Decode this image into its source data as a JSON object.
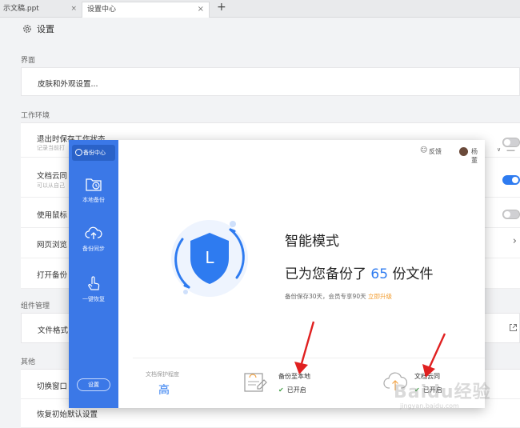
{
  "tabs": [
    {
      "label": "示文稿.ppt",
      "close": "×"
    },
    {
      "label": "设置中心",
      "close": "×"
    }
  ],
  "new_tab": "+",
  "settings": {
    "title": "设置",
    "sections": {
      "interface": "界面",
      "work_env": "工作环境",
      "components": "组件管理",
      "other": "其他"
    },
    "rows": {
      "skin": "皮肤和外观设置...",
      "save_on_exit": "退出时保存工作状态",
      "save_on_exit_sub": "记录当前打",
      "cloud_sync": "文档云同",
      "cloud_sync_sub": "可以从自己",
      "mouse": "使用鼠标",
      "web_browse": "网页浏览",
      "open_backup": "打开备份",
      "file_format": "文件格式",
      "switch_window": "切换窗口",
      "restore_default": "恢复初始默认设置"
    },
    "toggles": {
      "save_on_exit": false,
      "cloud_sync": true,
      "mouse": false
    }
  },
  "dialog": {
    "side": {
      "active_tab": "备份中心",
      "items": [
        "本地备份",
        "备份同步",
        "一键恢复"
      ],
      "settings_button": "设置"
    },
    "topbar": {
      "feedback": "反馈",
      "username": "杨 董",
      "dropdown": "∨",
      "minimize": "—",
      "close": "✕"
    },
    "headline": "智能模式",
    "stat_prefix": "已为您备份了 ",
    "stat_number": "65",
    "stat_suffix": " 份文件",
    "note": "备份保存30天，会员专享90天",
    "note_link": "立即升级",
    "shield_letter": "L",
    "level_label": "文档保护程度",
    "level_value": "高",
    "local_backup": {
      "title": "备份至本地",
      "status": "已开启"
    },
    "doc_cloud": {
      "title": "文档云同",
      "status": "已开启"
    }
  },
  "watermark": {
    "brand": "Baidu经验",
    "url": "jingyan.baidu.com"
  },
  "colors": {
    "accent": "#2e7bf0",
    "sidebar": "#3b78e7",
    "check": "#43a047",
    "upgrade": "#f29b2c"
  }
}
